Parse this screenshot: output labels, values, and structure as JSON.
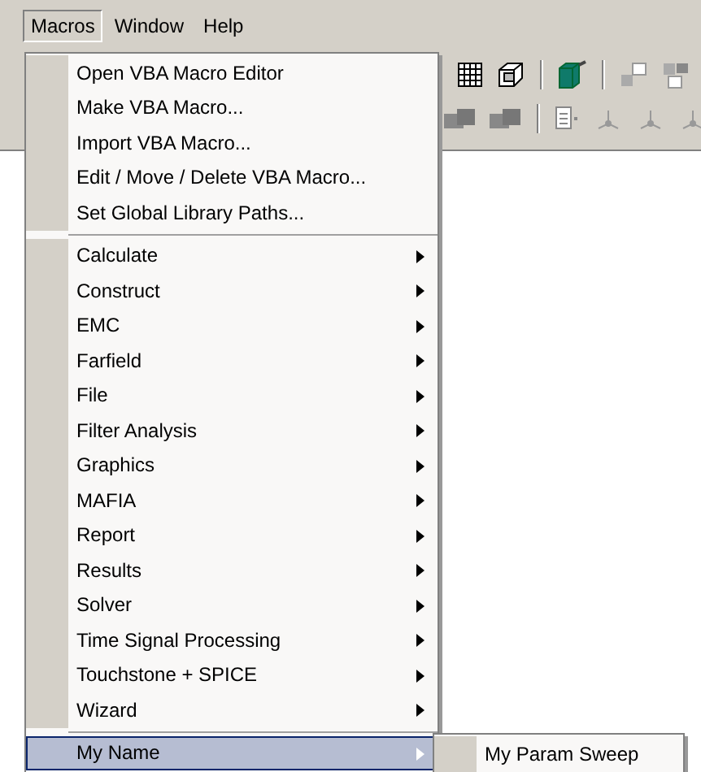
{
  "menubar": [
    {
      "label": "Macros",
      "selected": true
    },
    {
      "label": "Window",
      "selected": false
    },
    {
      "label": "Help",
      "selected": false
    }
  ],
  "menu": {
    "items": [
      {
        "kind": "command",
        "label": "Open VBA Macro Editor"
      },
      {
        "kind": "command",
        "label": "Make VBA Macro..."
      },
      {
        "kind": "command",
        "label": "Import VBA Macro..."
      },
      {
        "kind": "command",
        "label": "Edit / Move / Delete VBA Macro..."
      },
      {
        "kind": "command",
        "label": "Set Global Library Paths..."
      },
      {
        "kind": "separator"
      },
      {
        "kind": "submenu",
        "label": "Calculate",
        "selected": false
      },
      {
        "kind": "submenu",
        "label": "Construct",
        "selected": false
      },
      {
        "kind": "submenu",
        "label": "EMC",
        "selected": false
      },
      {
        "kind": "submenu",
        "label": "Farfield",
        "selected": false
      },
      {
        "kind": "submenu",
        "label": "File",
        "selected": false
      },
      {
        "kind": "submenu",
        "label": "Filter Analysis",
        "selected": false
      },
      {
        "kind": "submenu",
        "label": "Graphics",
        "selected": false
      },
      {
        "kind": "submenu",
        "label": "MAFIA",
        "selected": false
      },
      {
        "kind": "submenu",
        "label": "Report",
        "selected": false
      },
      {
        "kind": "submenu",
        "label": "Results",
        "selected": false
      },
      {
        "kind": "submenu",
        "label": "Solver",
        "selected": false
      },
      {
        "kind": "submenu",
        "label": "Time Signal Processing",
        "selected": false
      },
      {
        "kind": "submenu",
        "label": "Touchstone + SPICE",
        "selected": false
      },
      {
        "kind": "submenu",
        "label": "Wizard",
        "selected": false
      },
      {
        "kind": "separator"
      },
      {
        "kind": "submenu",
        "label": "My Name",
        "selected": true,
        "children": [
          {
            "label": "My Param Sweep"
          }
        ]
      }
    ]
  }
}
